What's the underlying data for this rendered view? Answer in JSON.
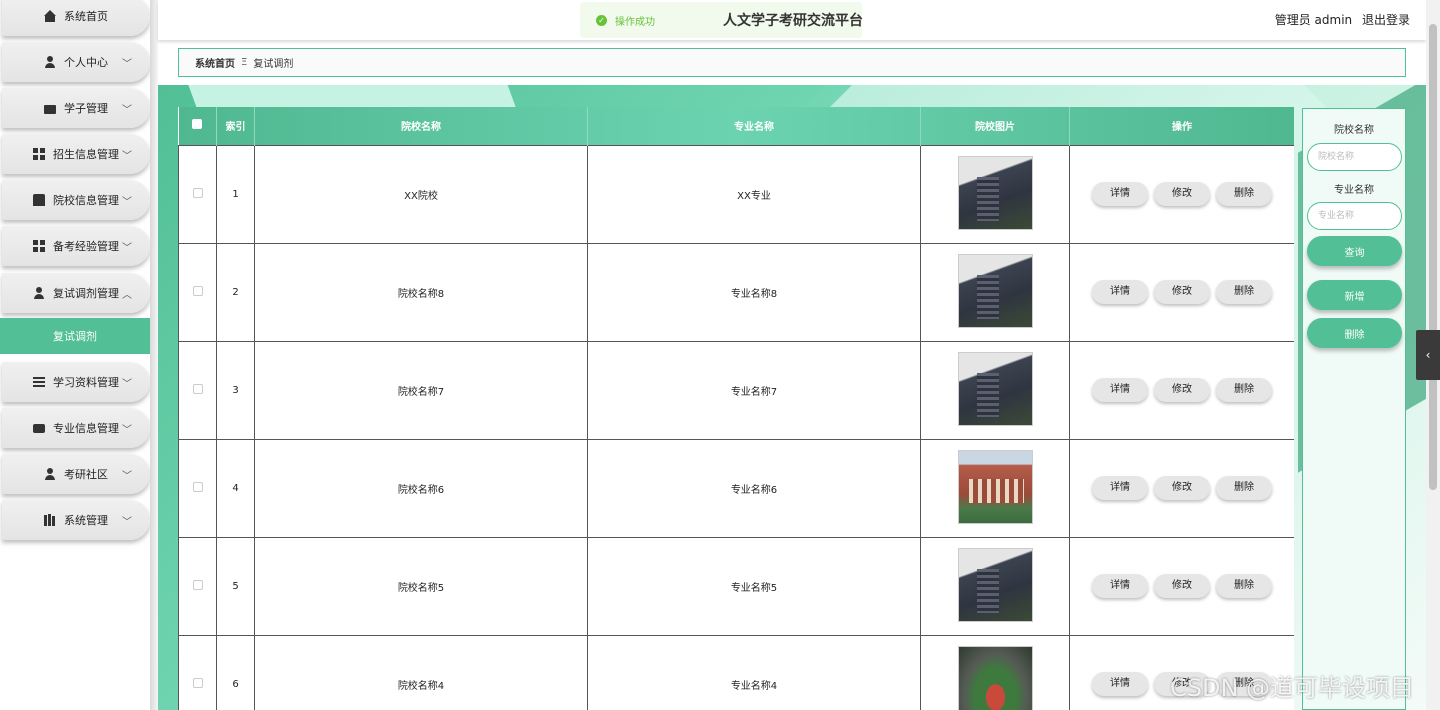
{
  "header": {
    "title": "人文学子考研交流平台",
    "toast": "操作成功",
    "user_label": "管理员 admin",
    "logout": "退出登录"
  },
  "sidebar": {
    "items": [
      {
        "label": "系统首页",
        "icon": "home-icon"
      },
      {
        "label": "个人中心",
        "icon": "user-icon"
      },
      {
        "label": "学子管理",
        "icon": "id-card-icon"
      },
      {
        "label": "招生信息管理",
        "icon": "grid-icon"
      },
      {
        "label": "院校信息管理",
        "icon": "book-icon"
      },
      {
        "label": "备考经验管理",
        "icon": "grid-icon"
      },
      {
        "label": "复试调剂管理",
        "icon": "user-icon"
      },
      {
        "label": "学习资料管理",
        "icon": "list-icon"
      },
      {
        "label": "专业信息管理",
        "icon": "chat-icon"
      },
      {
        "label": "考研社区",
        "icon": "user-icon"
      },
      {
        "label": "系统管理",
        "icon": "bar-chart-icon"
      }
    ],
    "active_sub": "复试调剂"
  },
  "breadcrumb": {
    "home": "系统首页",
    "current": "复试调剂"
  },
  "table": {
    "headers": [
      "索引",
      "院校名称",
      "专业名称",
      "院校图片",
      "操作"
    ],
    "actions": [
      "详情",
      "修改",
      "删除"
    ],
    "rows": [
      {
        "index": "1",
        "school": "XX院校",
        "major": "XX专业",
        "image": "dark-building"
      },
      {
        "index": "2",
        "school": "院校名称8",
        "major": "专业名称8",
        "image": "dark-building"
      },
      {
        "index": "3",
        "school": "院校名称7",
        "major": "专业名称7",
        "image": "dark-building"
      },
      {
        "index": "4",
        "school": "院校名称6",
        "major": "专业名称6",
        "image": "red-building"
      },
      {
        "index": "5",
        "school": "院校名称5",
        "major": "专业名称5",
        "image": "dark-building"
      },
      {
        "index": "6",
        "school": "院校名称4",
        "major": "专业名称4",
        "image": "campus-aerial"
      }
    ]
  },
  "search": {
    "school_label": "院校名称",
    "school_placeholder": "院校名称",
    "major_label": "专业名称",
    "major_placeholder": "专业名称",
    "query_btn": "查询",
    "add_btn": "新增",
    "delete_btn": "删除"
  },
  "watermark": "CSDN @道可毕设项目",
  "colors": {
    "accent": "#52bf96",
    "toast_green": "#67c23a"
  }
}
